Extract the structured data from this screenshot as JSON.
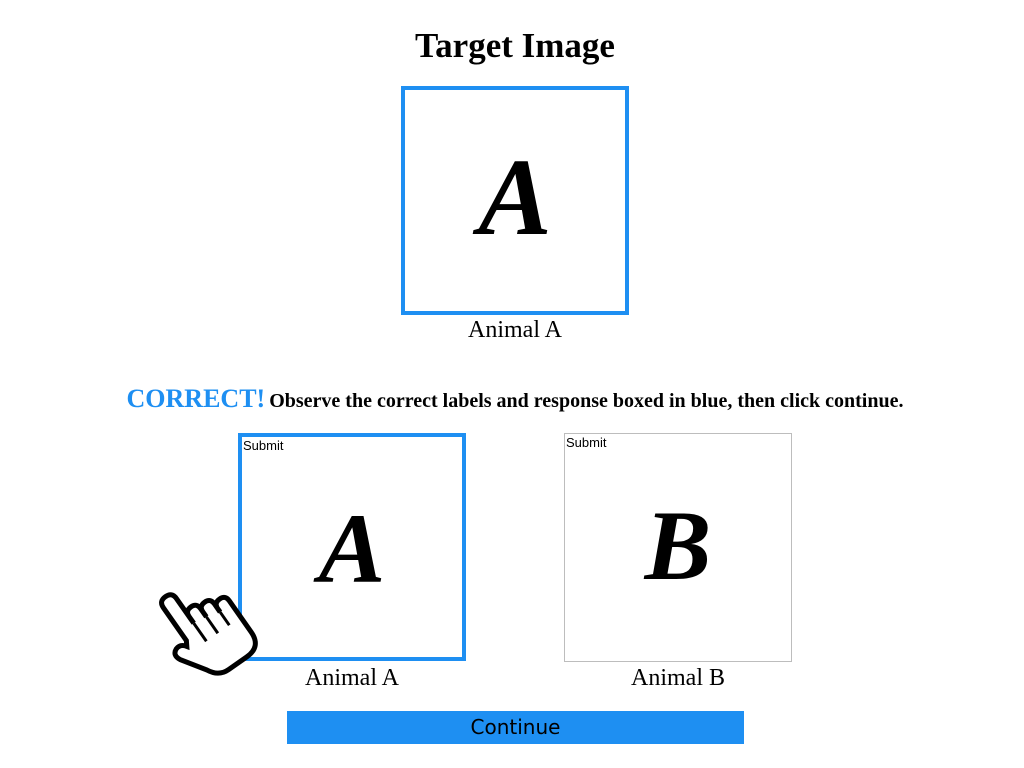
{
  "target": {
    "title": "Target Image",
    "glyph": "A",
    "label": "Animal A"
  },
  "feedback": {
    "status": "CORRECT!",
    "message": "Observe the correct labels and response boxed in blue, then click continue."
  },
  "choices": [
    {
      "submit_label": "Submit",
      "glyph": "A",
      "label": "Animal A",
      "selected": true
    },
    {
      "submit_label": "Submit",
      "glyph": "B",
      "label": "Animal B",
      "selected": false
    }
  ],
  "continue_label": "Continue",
  "colors": {
    "accent": "#1e8ff2",
    "border_gray": "#bdbdbd"
  },
  "cursor_icon": "pointing-hand-icon"
}
